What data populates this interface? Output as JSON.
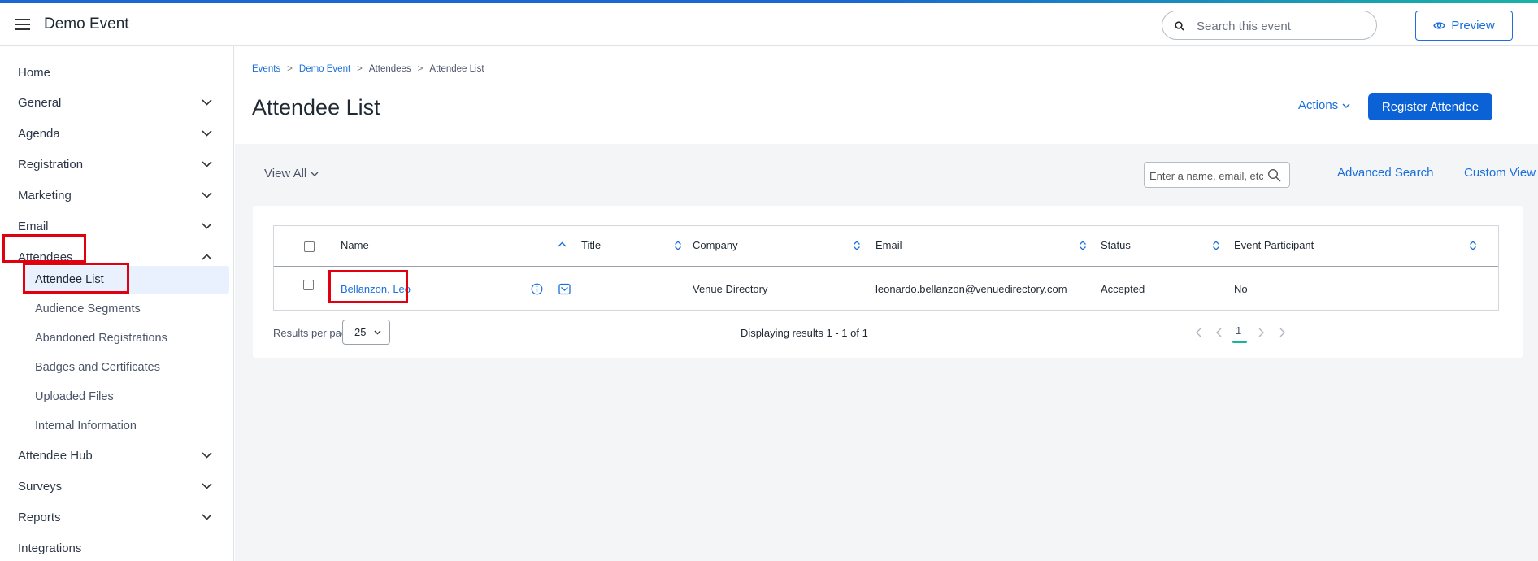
{
  "header": {
    "event_title": "Demo Event",
    "search_placeholder": "Search this event",
    "preview_label": "Preview"
  },
  "sidebar": {
    "items": [
      {
        "label": "Home",
        "chevron": "none"
      },
      {
        "label": "General",
        "chevron": "down"
      },
      {
        "label": "Agenda",
        "chevron": "down"
      },
      {
        "label": "Registration",
        "chevron": "down"
      },
      {
        "label": "Marketing",
        "chevron": "down"
      },
      {
        "label": "Email",
        "chevron": "down"
      },
      {
        "label": "Attendees",
        "chevron": "up"
      },
      {
        "label": "Attendee Hub",
        "chevron": "down"
      },
      {
        "label": "Surveys",
        "chevron": "down"
      },
      {
        "label": "Reports",
        "chevron": "down"
      },
      {
        "label": "Integrations",
        "chevron": "none"
      }
    ],
    "attendees_subitems": [
      {
        "label": "Attendee List",
        "active": true
      },
      {
        "label": "Audience Segments"
      },
      {
        "label": "Abandoned Registrations"
      },
      {
        "label": "Badges and Certificates"
      },
      {
        "label": "Uploaded Files"
      },
      {
        "label": "Internal Information"
      }
    ]
  },
  "breadcrumb": [
    "Events",
    "Demo Event",
    "Attendees",
    "Attendee List"
  ],
  "page": {
    "title": "Attendee List",
    "actions_label": "Actions",
    "register_label": "Register Attendee"
  },
  "toolbar": {
    "view_all_label": "View All",
    "filter_placeholder": "Enter a name, email, etc...",
    "advanced_search_label": "Advanced Search",
    "custom_view_label": "Custom View"
  },
  "table": {
    "columns": [
      "Name",
      "Title",
      "Company",
      "Email",
      "Status",
      "Event Participant"
    ],
    "rows": [
      {
        "name": "Bellanzon, Leo",
        "title": "",
        "company": "Venue Directory",
        "email": "leonardo.bellanzon@venuedirectory.com",
        "status": "Accepted",
        "event_participant": "No"
      }
    ]
  },
  "pagination": {
    "rpp_label": "Results per page",
    "rpp_value": "25",
    "displaying_text": "Displaying results 1 - 1 of 1",
    "current_page": "1"
  },
  "colors": {
    "accent": "#1a6fdc",
    "primary_button": "#0a62d6",
    "highlight_box": "#e0000f",
    "page_indicator": "#19b39a"
  }
}
